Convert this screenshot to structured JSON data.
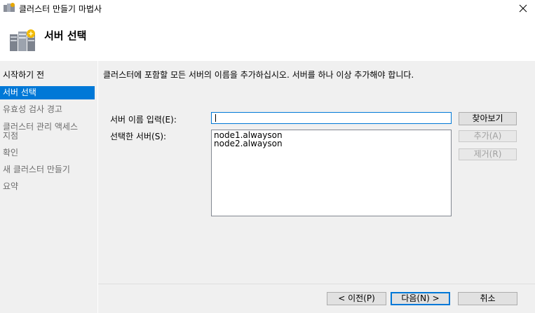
{
  "window": {
    "title": "클러스터 만들기 마법사",
    "icon": "cluster-wizard-icon"
  },
  "header": {
    "title": "서버 선택",
    "icon": "servers-icon"
  },
  "sidebar": {
    "items": [
      {
        "label": "시작하기 전",
        "state": "normal"
      },
      {
        "label": "서버 선택",
        "state": "selected"
      },
      {
        "label": "유효성 검사 경고",
        "state": "muted"
      },
      {
        "label": "클러스터 관리 액세스 지점",
        "state": "muted"
      },
      {
        "label": "확인",
        "state": "muted"
      },
      {
        "label": "새 클러스터 만들기",
        "state": "muted"
      },
      {
        "label": "요약",
        "state": "muted"
      }
    ]
  },
  "main": {
    "instruction": "클러스터에 포함할 모든 서버의 이름을 추가하십시오. 서버를 하나 이상 추가해야 합니다.",
    "server_name_label": "서버 이름 입력(E):",
    "server_name_value": "",
    "selected_servers_label": "선택한 서버(S):",
    "selected_servers": [
      "node1.alwayson",
      "node2.alwayson"
    ],
    "browse_label": "찾아보기",
    "add_label": "추가(A)",
    "remove_label": "제거(R)"
  },
  "footer": {
    "prev_label": "< 이전(P)",
    "next_label": "다음(N) >",
    "cancel_label": "취소"
  },
  "colors": {
    "accent": "#0078d7",
    "panel": "#f0f0f0",
    "muted_text": "#6d6d6d"
  }
}
